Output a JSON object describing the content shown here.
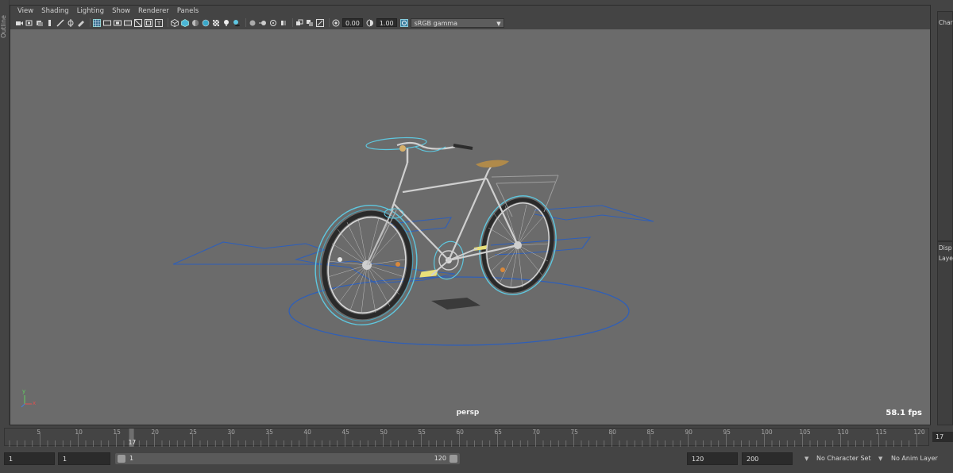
{
  "outliner_tab": "Outline",
  "menu": [
    "View",
    "Shading",
    "Lighting",
    "Show",
    "Renderer",
    "Panels"
  ],
  "toolbar": {
    "exposure_value": "0.00",
    "gamma_value": "1.00",
    "color_space": "sRGB gamma"
  },
  "viewport": {
    "camera": "persp",
    "fps": "58.1 fps",
    "axis_x": "x",
    "axis_y": "y",
    "background": "#6b6b6b"
  },
  "right_panel": {
    "channel_box_tab": "Char",
    "display_tab": "Disp",
    "layers_tab": "Laye"
  },
  "timeline": {
    "ticks": [
      "5",
      "10",
      "15",
      "20",
      "25",
      "30",
      "35",
      "40",
      "45",
      "50",
      "55",
      "60",
      "65",
      "70",
      "75",
      "80",
      "85",
      "90",
      "95",
      "100",
      "105",
      "110",
      "115",
      "120"
    ],
    "current_frame": "17",
    "current_frame_field": "17"
  },
  "range": {
    "start_time": "1",
    "playback_start": "1",
    "slider_start": "1",
    "slider_end": "120",
    "playback_end": "120",
    "end_time": "200",
    "character_set": "No Character Set",
    "anim_layer": "No Anim Layer"
  },
  "colors": {
    "accent": "#5ec8e0",
    "curve_blue": "#2f5fb8",
    "seat": "#b08a4a"
  }
}
